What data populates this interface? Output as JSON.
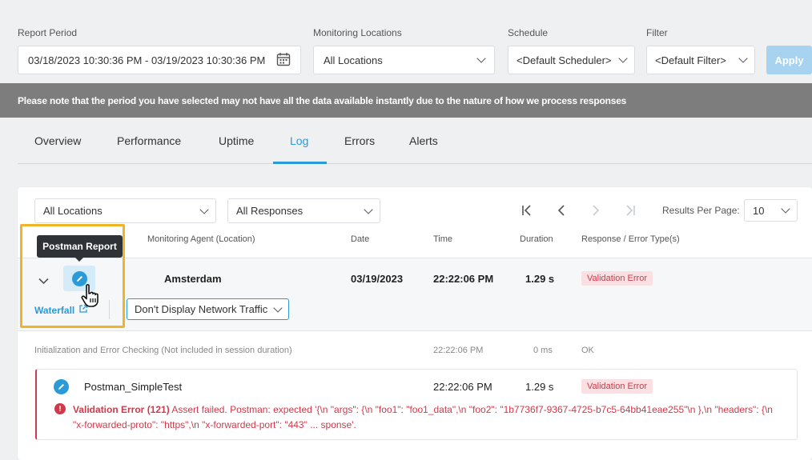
{
  "filters": {
    "report_period_label": "Report Period",
    "report_period_value": "03/18/2023 10:30:36 PM - 03/19/2023 10:30:36 PM",
    "locations_label": "Monitoring Locations",
    "locations_value": "All Locations",
    "schedule_label": "Schedule",
    "schedule_value": "<Default Scheduler>",
    "filter_label": "Filter",
    "filter_value": "<Default Filter>",
    "apply_label": "Apply"
  },
  "notice": "Please note that the period you have selected may not have all the data available instantly due to the nature of how we process responses",
  "tabs": [
    {
      "label": "Overview"
    },
    {
      "label": "Performance"
    },
    {
      "label": "Uptime"
    },
    {
      "label": "Log"
    },
    {
      "label": "Errors"
    },
    {
      "label": "Alerts"
    }
  ],
  "active_tab": "Log",
  "log": {
    "location_select": "All Locations",
    "response_select": "All Responses",
    "results_per_page_label": "Results Per Page:",
    "results_per_page_value": "10",
    "columns": {
      "agent": "Monitoring Agent (Location)",
      "date": "Date",
      "time": "Time",
      "duration": "Duration",
      "response": "Response / Error Type(s)"
    },
    "row": {
      "agent": "Amsterdam",
      "date": "03/19/2023",
      "time": "22:22:06 PM",
      "duration": "1.29 s",
      "response": "Validation Error",
      "waterfall_label": "Waterfall",
      "network_select": "Don't Display Network Traffic"
    },
    "tooltip": "Postman Report",
    "init_row": {
      "label": "Initialization and Error Checking (Not included in session duration)",
      "time": "22:22:06 PM",
      "duration": "0 ms",
      "status": "OK"
    },
    "step": {
      "name": "Postman_SimpleTest",
      "time": "22:22:06 PM",
      "duration": "1.29 s",
      "response": "Validation Error",
      "error_title": "Validation Error (121)",
      "error_message": " Assert failed. Postman: expected '{\\n \"args\": {\\n \"foo1\": \"foo1_data\",\\n \"foo2\": \"1b7736f7-9367-4725-b7c5-64bb41eae255\"\\n },\\n \"headers\": {\\n \"x-forwarded-proto\": \"https\",\\n \"x-forwarded-port\": \"443\" ... sponse'."
    }
  },
  "colors": {
    "accent": "#2a9ad8",
    "error": "#d0394a",
    "highlight": "#f0b429"
  }
}
